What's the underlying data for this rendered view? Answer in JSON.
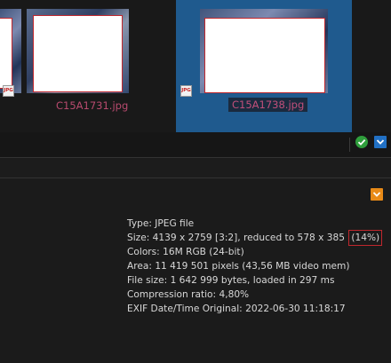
{
  "thumbnails": [
    {
      "filename": "C15A1731.jpg",
      "selected": false,
      "badge": "JPG"
    },
    {
      "filename": "C15A1738.jpg",
      "selected": true,
      "badge": "JPG"
    }
  ],
  "toolbar": {
    "ok_icon": "checkmark-circle-icon",
    "dropdown_icon": "chevron-down-icon"
  },
  "info_panel": {
    "collapse_icon": "chevron-down-icon",
    "lines": {
      "type": "Type: JPEG file",
      "size_prefix": "Size: 4139 x 2759 [3:2], reduced to 578 x 385 ",
      "size_percent": "(14%)",
      "colors": "Colors: 16M RGB (24-bit)",
      "area": "Area: 11 419 501 pixels (43,56 MB video mem)",
      "file_size": "File size: 1 642 999 bytes, loaded in 297 ms",
      "compression": "Compression ratio: 4,80%",
      "exif_date": "EXIF Date/Time Original: 2022-06-30 11:18:17"
    }
  },
  "colors": {
    "selection": "#1f5a8e",
    "accent_orange": "#e88a17",
    "ok_green": "#2f9e3c",
    "highlight_red": "#c0272d"
  }
}
